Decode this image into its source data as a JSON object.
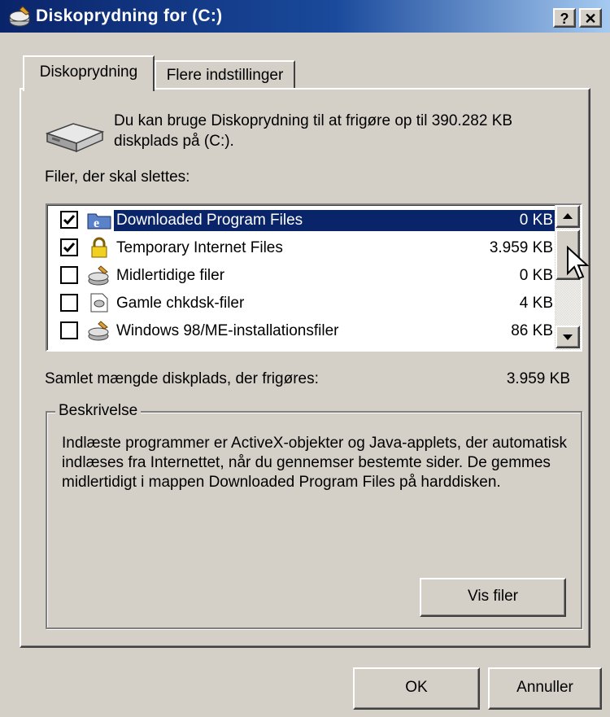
{
  "window": {
    "title": "Diskoprydning for  (C:)",
    "help_label": "?",
    "close_label": "✕"
  },
  "tabs": [
    {
      "label": "Diskoprydning",
      "active": true
    },
    {
      "label": "Flere indstillinger",
      "active": false
    }
  ],
  "info": {
    "text_line1": "Du kan bruge Diskoprydning til at frigøre op til 390.282 KB",
    "text_line2": "diskplads på  (C:)."
  },
  "files_label": "Filer, der skal slettes:",
  "files": [
    {
      "name": "Downloaded Program Files",
      "size": "0 KB",
      "checked": true,
      "selected": true,
      "icon": "ie-folder-icon"
    },
    {
      "name": "Temporary Internet Files",
      "size": "3.959 KB",
      "checked": true,
      "selected": false,
      "icon": "lock-icon"
    },
    {
      "name": "Midlertidige filer",
      "size": "0 KB",
      "checked": false,
      "selected": false,
      "icon": "recycle-icon"
    },
    {
      "name": "Gamle chkdsk-filer",
      "size": "4 KB",
      "checked": false,
      "selected": false,
      "icon": "file-icon"
    },
    {
      "name": "Windows 98/ME-installationsfiler",
      "size": "86 KB",
      "checked": false,
      "selected": false,
      "icon": "recycle-icon"
    }
  ],
  "total": {
    "label": "Samlet mængde diskplads, der frigøres:",
    "value": "3.959 KB"
  },
  "description": {
    "title": "Beskrivelse",
    "text": "Indlæste programmer er ActiveX-objekter og Java-applets, der automatisk indlæses fra Internettet, når du gennemser bestemte sider. De gemmes midlertidigt i mappen Downloaded Program Files på harddisken."
  },
  "buttons": {
    "view_files": "Vis filer",
    "ok": "OK",
    "cancel": "Annuller"
  },
  "colors": {
    "selection": "#0a246a",
    "titlebar_start": "#0a246a",
    "titlebar_end": "#a6caf0",
    "face": "#d4d0c8"
  }
}
